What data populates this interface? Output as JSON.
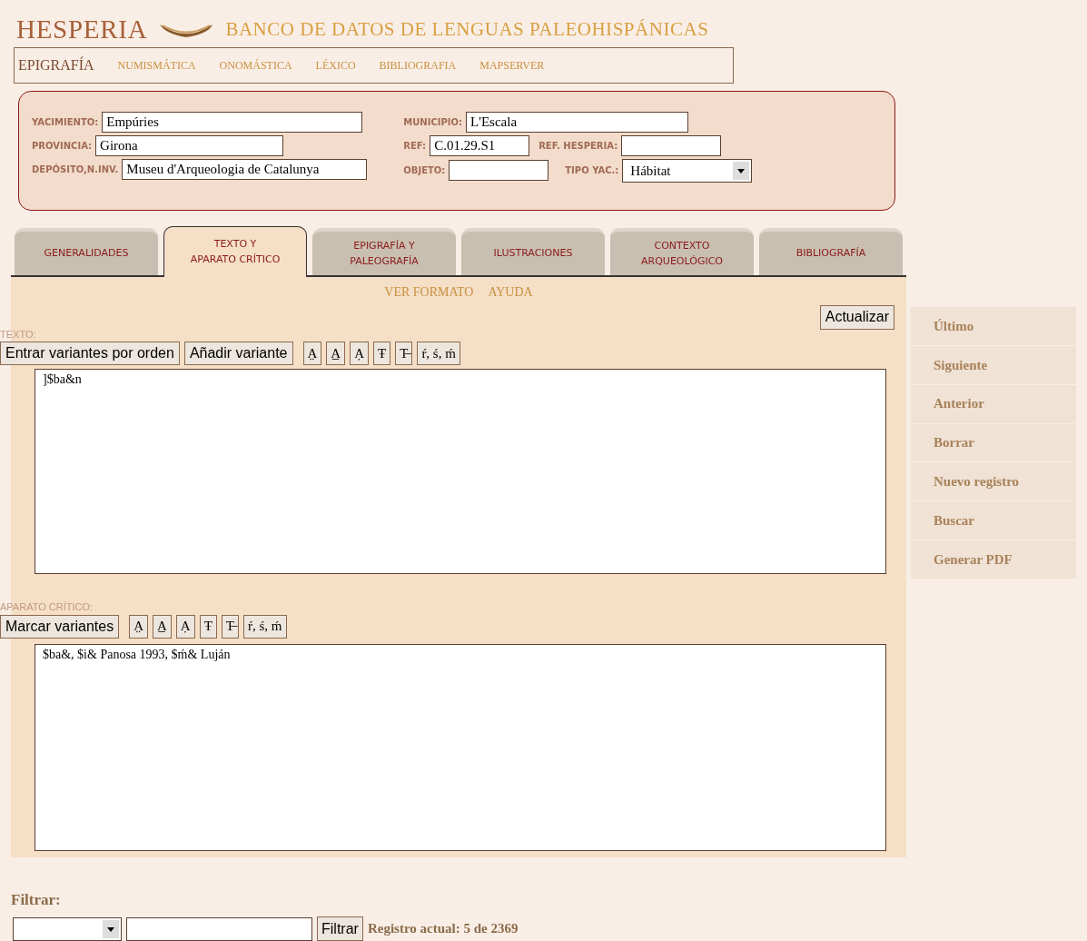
{
  "header": {
    "brand": "HESPERIA",
    "subtitle": "BANCO DE DATOS DE LENGUAS PALEOHISPÁNICAS"
  },
  "nav": [
    {
      "label": "EPIGRAFÍA",
      "selected": true
    },
    {
      "label": "NUMISMÁTICA",
      "selected": false
    },
    {
      "label": "ONOMÁSTICA",
      "selected": false
    },
    {
      "label": "LÉXICO",
      "selected": false
    },
    {
      "label": "BIBLIOGRAFIA",
      "selected": false
    },
    {
      "label": "MAPSERVER",
      "selected": false
    }
  ],
  "record": {
    "yacimiento": {
      "label": "YACIMIENTO:",
      "value": "Empúries"
    },
    "provincia": {
      "label": "PROVINCIA:",
      "value": "Girona"
    },
    "deposito": {
      "label": "DEPÓSITO,N.INV.",
      "value": "Museu d'Arqueologia de Catalunya"
    },
    "municipio": {
      "label": "MUNICIPIO:",
      "value": "L'Escala"
    },
    "ref": {
      "label": "REF:",
      "value": "C.01.29.S1"
    },
    "ref_hesperia": {
      "label": "REF. HESPERIA:"
    },
    "objeto": {
      "label": "OBJETO:"
    },
    "tipo_yac": {
      "label": "TIPO YAC.:",
      "value": "Hábitat"
    }
  },
  "tabs": [
    {
      "lines": [
        "GENERALIDADES"
      ],
      "selected": false
    },
    {
      "lines": [
        "TEXTO Y",
        "APARATO CRÍTICO"
      ],
      "selected": true
    },
    {
      "lines": [
        "EPIGRAFÍA Y",
        "PALEOGRAFÍA"
      ],
      "selected": false
    },
    {
      "lines": [
        "ILUSTRACIONES"
      ],
      "selected": false
    },
    {
      "lines": [
        "CONTEXTO",
        "ARQUEOLÓGICO"
      ],
      "selected": false
    },
    {
      "lines": [
        "BIBLIOGRAFÍA"
      ],
      "selected": false
    }
  ],
  "links": [
    "VER FORMATO",
    "AYUDA"
  ],
  "update_button": "Actualizar",
  "texto": {
    "label": "TEXTO:",
    "buttons": [
      "Entrar variantes por orden",
      "Añadir variante"
    ],
    "marks": [
      "A̤",
      "A̲",
      "Ạ",
      "Ŧ",
      "T̶",
      "ŕ, ś, ḿ"
    ],
    "value": "]$ba&n"
  },
  "aparato": {
    "label": "APARATO CRÍTICO:",
    "buttons": [
      "Marcar variantes"
    ],
    "marks": [
      "A̤",
      "A̲",
      "Ạ",
      "Ŧ",
      "T̶",
      "ŕ, ś, ḿ"
    ],
    "value": "$ba&, $i& Panosa 1993, $ḿ& Luján"
  },
  "sidebar": [
    "Último",
    "Siguiente",
    "Anterior",
    "Borrar",
    "Nuevo registro",
    "Buscar",
    "Generar PDF"
  ],
  "filter": {
    "title": "Filtrar:",
    "button": "Filtrar",
    "status": "Registro actual: 5 de 2369"
  }
}
